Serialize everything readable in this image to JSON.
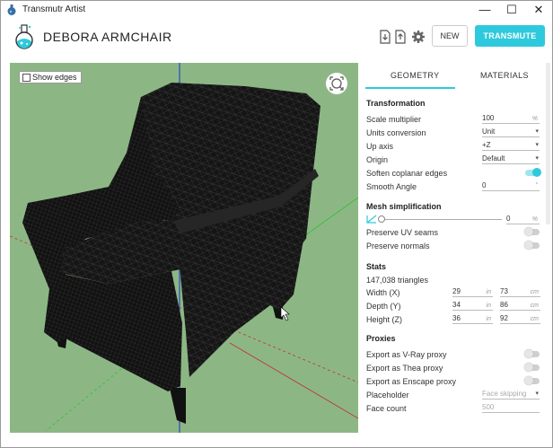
{
  "window": {
    "title": "Transmutr Artist",
    "minimize": "—",
    "maximize": "☐",
    "close": "✕"
  },
  "header": {
    "document_name": "DEBORA ARMCHAIR",
    "new_label": "NEW",
    "transmute_label": "TRANSMUTE"
  },
  "viewport": {
    "show_edges_label": "Show edges",
    "show_edges_checked": false,
    "background": "#8cb785"
  },
  "tabs": {
    "geometry": "GEOMETRY",
    "materials": "MATERIALS",
    "active": "geometry"
  },
  "transformation": {
    "title": "Transformation",
    "scale_label": "Scale multiplier",
    "scale_value": "100",
    "scale_unit": "%",
    "units_label": "Units conversion",
    "units_value": "Unit",
    "upaxis_label": "Up axis",
    "upaxis_value": "+Z",
    "origin_label": "Origin",
    "origin_value": "Default",
    "soften_label": "Soften coplanar edges",
    "soften_on": true,
    "smooth_label": "Smooth Angle",
    "smooth_value": "0",
    "smooth_unit": "°"
  },
  "mesh": {
    "title": "Mesh simplification",
    "slider_value": "0",
    "slider_unit": "%",
    "slider_fraction": 0,
    "preserve_uv_label": "Preserve UV seams",
    "preserve_uv_on": false,
    "preserve_normals_label": "Preserve normals",
    "preserve_normals_on": false
  },
  "stats": {
    "title": "Stats",
    "triangles": "147,038 triangles",
    "width_label": "Width (X)",
    "width_in": "29",
    "width_cm": "73",
    "depth_label": "Depth (Y)",
    "depth_in": "34",
    "depth_cm": "86",
    "height_label": "Height (Z)",
    "height_in": "36",
    "height_cm": "92",
    "unit_in": "in",
    "unit_cm": "cm"
  },
  "proxies": {
    "title": "Proxies",
    "vray_label": "Export as V-Ray proxy",
    "vray_on": false,
    "thea_label": "Export as Thea proxy",
    "thea_on": false,
    "enscape_label": "Export as Enscape proxy",
    "enscape_on": false,
    "placeholder_label": "Placeholder",
    "placeholder_value": "Face skipping",
    "facecount_label": "Face count",
    "facecount_value": "500"
  },
  "colors": {
    "accent": "#2fc9dd",
    "viewport_green": "#8cb785"
  }
}
